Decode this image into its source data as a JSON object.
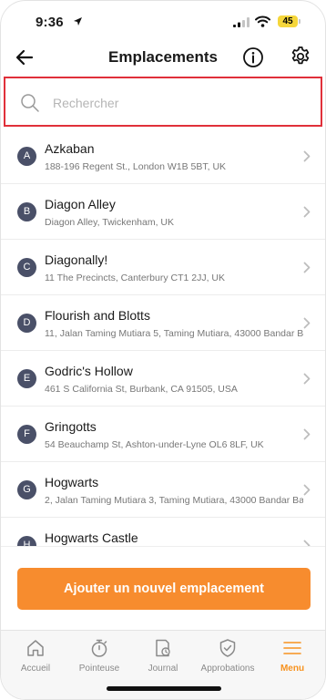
{
  "status_bar": {
    "time": "9:36",
    "battery": "45"
  },
  "header": {
    "title": "Emplacements"
  },
  "search": {
    "placeholder": "Rechercher"
  },
  "locations": [
    {
      "letter": "A",
      "name": "Azkaban",
      "address": "188-196 Regent St., London W1B 5BT, UK"
    },
    {
      "letter": "B",
      "name": "Diagon Alley",
      "address": "Diagon Alley, Twickenham, UK"
    },
    {
      "letter": "C",
      "name": "Diagonally!",
      "address": "11 The Precincts, Canterbury CT1 2JJ, UK"
    },
    {
      "letter": "D",
      "name": "Flourish and Blotts",
      "address": "11, Jalan Taming Mutiara 5, Taming Mutiara, 43000 Bandar B"
    },
    {
      "letter": "E",
      "name": "Godric's Hollow",
      "address": "461 S California St, Burbank, CA 91505, USA"
    },
    {
      "letter": "F",
      "name": "Gringotts",
      "address": "54 Beauchamp St, Ashton-under-Lyne OL6 8LF, UK"
    },
    {
      "letter": "G",
      "name": "Hogwarts",
      "address": "2, Jalan Taming Mutiara 3, Taming Mutiara, 43000 Bandar Bar"
    },
    {
      "letter": "H",
      "name": "Hogwarts Castle",
      "address": ""
    }
  ],
  "actions": {
    "add_label": "Ajouter un nouvel emplacement"
  },
  "tabs": [
    {
      "label": "Accueil",
      "icon": "home-icon",
      "active": false
    },
    {
      "label": "Pointeuse",
      "icon": "stopwatch-icon",
      "active": false
    },
    {
      "label": "Journal",
      "icon": "journal-icon",
      "active": false
    },
    {
      "label": "Approbations",
      "icon": "shield-check-icon",
      "active": false
    },
    {
      "label": "Menu",
      "icon": "menu-icon",
      "active": true
    }
  ],
  "colors": {
    "accent": "#f78c2e",
    "avatar": "#4a5068",
    "search_border": "#e0303a"
  }
}
